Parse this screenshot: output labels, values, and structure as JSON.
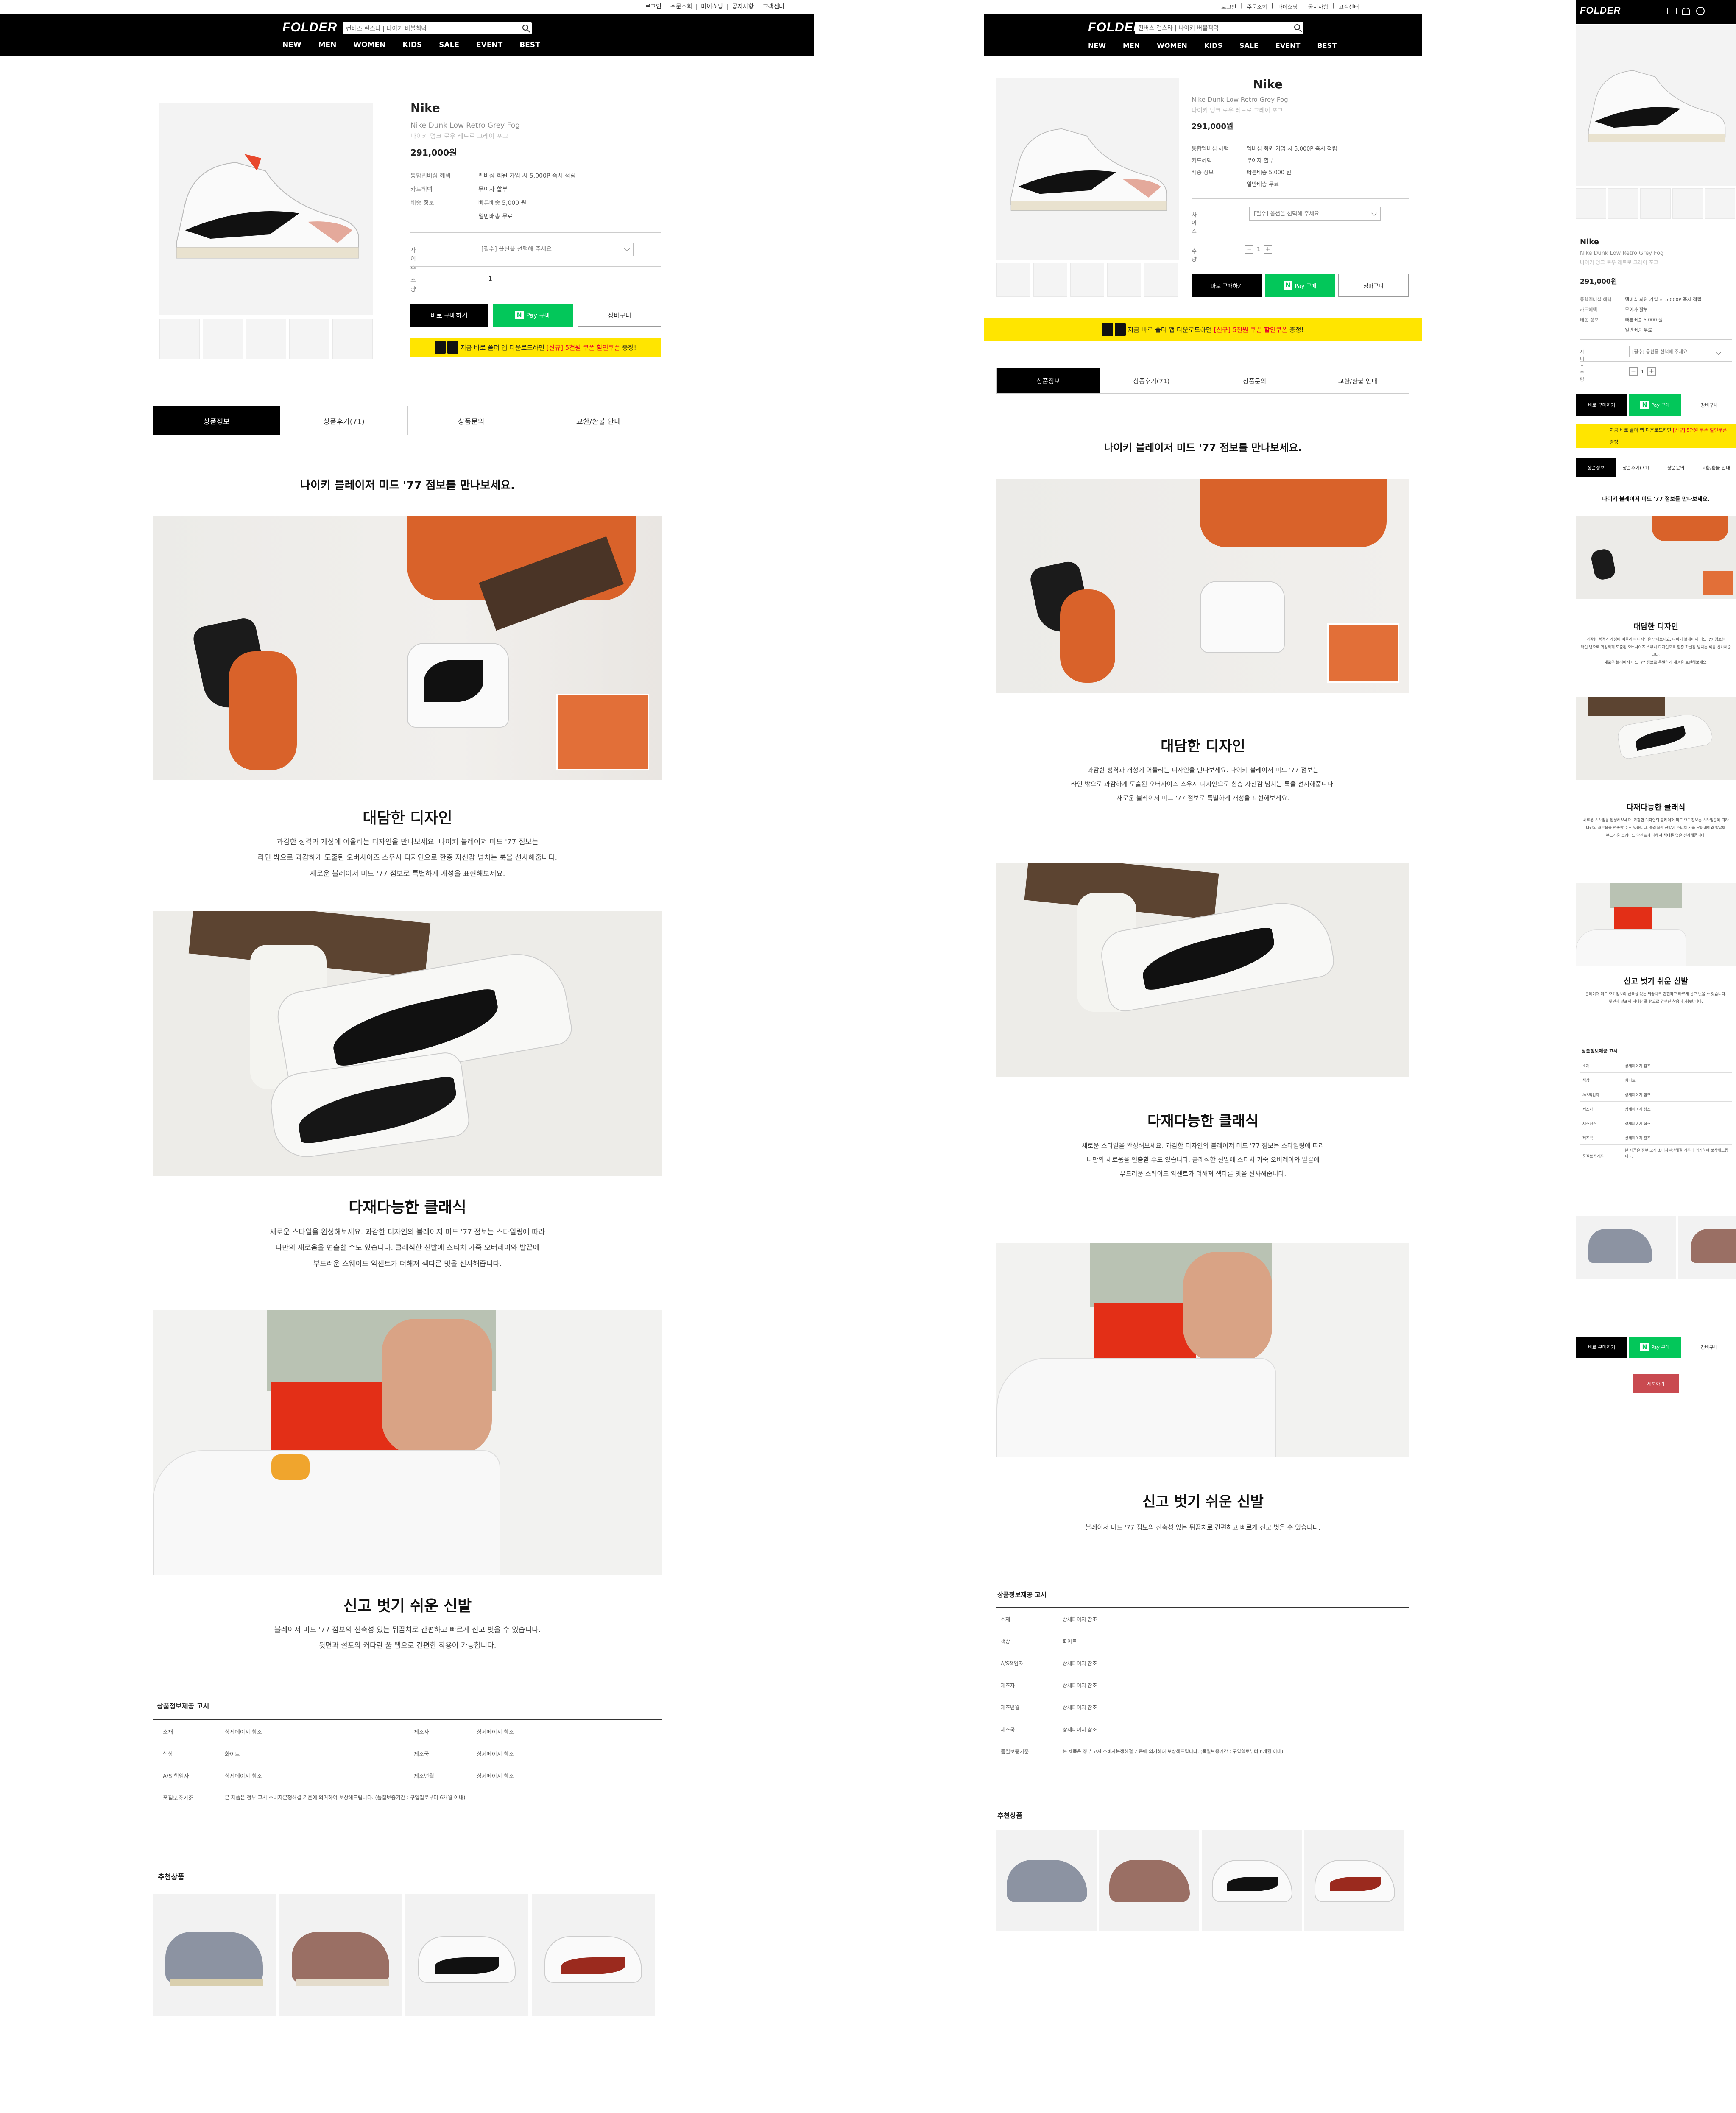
{
  "site": {
    "logo": "FOLDER",
    "search_placeholder": "컨버스 런스타 | 나이키 버블첵덕",
    "util_links": [
      "로그인",
      "주문조회",
      "마이쇼핑",
      "공지사항",
      "고객센터"
    ],
    "nav": [
      "NEW",
      "MEN",
      "WOMEN",
      "KIDS",
      "SALE",
      "EVENT",
      "BEST"
    ]
  },
  "product": {
    "brand": "Nike",
    "name_en": "Nike Dunk Low Retro Grey Fog",
    "name_ko": "나이키 덩크 로우 레트로 그레이 포그",
    "price": "291,000원",
    "info_rows": [
      {
        "k": "통합멤버십 혜택",
        "v": "멤버십 회원 가입 시 5,000P 즉시 적립"
      },
      {
        "k": "카드혜택",
        "v": "무이자 할부"
      },
      {
        "k": "배송 정보",
        "v": "빠른배송 5,000 원"
      },
      {
        "k": "",
        "v": "일반배송 무료"
      }
    ],
    "size_label": "사이즈",
    "size_placeholder": "[필수] 옵션을 선택해 주세요",
    "qty_label": "수량",
    "qty_minus": "−",
    "qty_value": "1",
    "qty_plus": "+",
    "buy_now": "바로 구매하기",
    "npay_mark": "N",
    "npay": "Pay 구매",
    "wishlist": "장바구니",
    "banner_text": "지금 바로 폴더 앱 다운로드하면",
    "banner_hl": "[신규] 5천원 쿠폰 할인쿠폰",
    "banner_tail": "증정!"
  },
  "tabs": [
    "상품정보",
    "상품후기(71)",
    "상품문의",
    "교환/환불 안내"
  ],
  "tabs_mobile": [
    "상품정보",
    "상품후기(71)",
    "상품문의",
    "교환/환불 안내"
  ],
  "content": {
    "intro": "나이키 블레이저 미드 '77 점보를 만나보세요.",
    "s1_title": "대담한 디자인",
    "s1_lines": [
      "과감한 성격과 개성에 어울리는 디자인을 만나보세요. 나이키 블레이저 미드 '77 점보는",
      "라인 밖으로 과감하게 도출된 오버사이즈 스우시 디자인으로 한층 자신감 넘치는 룩을 선사해줍니다.",
      "새로운 블레이저 미드 '77 점보로 특별하게 개성을 표현해보세요."
    ],
    "s2_title": "다재다능한 클래식",
    "s2_lines": [
      "새로운 스타일을 완성해보세요. 과감한 디자인의 블레이저 미드 '77 점보는 스타일링에 따라",
      "나만의 새로움을 연출할 수도 있습니다. 클래식한 신발에 스티치 가죽 오버레이와 발끝에",
      "부드러운 스웨이드 악센트가 더해져 색다른 멋을 선사해줍니다."
    ],
    "s3_title": "신고 벗기 쉬운 신발",
    "s3_lines": [
      "블레이저 미드 '77 점보의 신축성 있는 뒤꿈치로 간편하고 빠르게 신고 벗을 수 있습니다.",
      "뒷면과 설포의 커다란 풀 탭으로 간편한 착용이 가능합니다."
    ],
    "s3_lines_tablet": [
      "블레이저 미드 '77 점보의 신축성 있는 뒤꿈치로 간편하고 빠르게 신고 벗을 수 있습니다."
    ]
  },
  "notice": {
    "title": "상품정보제공 고시",
    "rows_desktop": [
      [
        "소재",
        "상세페이지 참조",
        "제조자",
        "상세페이지 참조"
      ],
      [
        "색상",
        "화이트",
        "제조국",
        "상세페이지 참조"
      ],
      [
        "A/S 책임자",
        "상세페이지 참조",
        "제조년월",
        "상세페이지 참조"
      ],
      [
        "품질보증기준",
        "본 제품은 정부 고시 소비자분쟁해결 기준에 의거하여 보상해드립니다. (품질보증기간 : 구입일로부터 6개월 이내)",
        "",
        ""
      ]
    ],
    "rows_tablet": [
      [
        "소재",
        "상세페이지 참조"
      ],
      [
        "색상",
        "화이트"
      ],
      [
        "A/S책임자",
        "상세페이지 참조"
      ],
      [
        "제조자",
        "상세페이지 참조"
      ],
      [
        "제조년월",
        "상세페이지 참조"
      ],
      [
        "제조국",
        "상세페이지 참조"
      ],
      [
        "품질보증기준",
        "본 제품은 정부 고시 소비자분쟁해결 기준에 의거하여 보상해드립니다. (품질보증기간 : 구입일로부터 6개월 이내)"
      ]
    ],
    "rows_mobile": [
      [
        "소재",
        "상세페이지 참조"
      ],
      [
        "색상",
        "화이트"
      ],
      [
        "A/S책임자",
        "상세페이지 참조"
      ],
      [
        "제조자",
        "상세페이지 참조"
      ],
      [
        "제조년월",
        "상세페이지 참조"
      ],
      [
        "제조국",
        "상세페이지 참조"
      ],
      [
        "품질보증기준",
        "본 제품은 정부 고시 소비자분쟁해결 기준에 의거하여 보상해드립니다."
      ]
    ]
  },
  "recommend": {
    "title": "추천상품"
  },
  "mobile": {
    "report": "제보하기"
  },
  "colors": {
    "black": "#000000",
    "npay_green": "#03c75a",
    "banner_yellow": "#ffe500",
    "highlight_red": "#e8002d",
    "report_red": "#c94a50"
  }
}
